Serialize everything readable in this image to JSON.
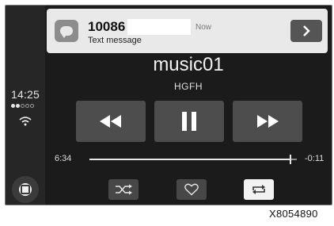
{
  "status": {
    "clock": "14:25",
    "signal_bars_on": 2,
    "signal_bars_total": 5
  },
  "notification": {
    "sender": "10086",
    "subtitle": "Text message",
    "time": "Now",
    "icon": "message-icon",
    "action_icon": "chevron-right-icon"
  },
  "now_playing": {
    "title": "music01",
    "artist": "HGFH",
    "elapsed": "6:34",
    "remaining": "-0:11",
    "progress": 0.97
  },
  "controls": {
    "prev_icon": "rewind-icon",
    "play_icon": "pause-icon",
    "next_icon": "fast-forward-icon",
    "shuffle_icon": "shuffle-icon",
    "favorite_icon": "heart-icon",
    "repeat_icon": "repeat-icon",
    "repeat_active": true
  },
  "home": {
    "icon": "home-button-icon"
  },
  "figure_code": "X8054890"
}
